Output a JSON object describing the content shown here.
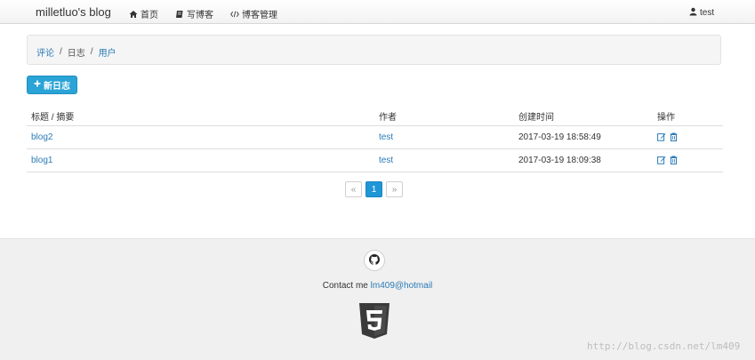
{
  "navbar": {
    "brand": "milletluo's blog",
    "items": [
      {
        "label": "首页",
        "icon": "home-icon"
      },
      {
        "label": "写博客",
        "icon": "book-icon"
      },
      {
        "label": "博客管理",
        "icon": "code-icon"
      }
    ],
    "user": {
      "label": "test",
      "icon": "user-icon"
    }
  },
  "breadcrumb": {
    "items": [
      {
        "label": "评论",
        "active": false
      },
      {
        "label": "日志",
        "active": true
      },
      {
        "label": "用户",
        "active": false
      }
    ],
    "separator": "/"
  },
  "actions": {
    "new_button": "新日志",
    "new_icon": "plus-icon"
  },
  "table": {
    "headers": [
      "标题 / 摘要",
      "作者",
      "创建时间",
      "操作"
    ],
    "rows": [
      {
        "title": "blog2",
        "author": "test",
        "created": "2017-03-19 18:58:49"
      },
      {
        "title": "blog1",
        "author": "test",
        "created": "2017-03-19 18:09:38"
      }
    ],
    "op_icons": [
      "edit-icon",
      "trash-icon"
    ]
  },
  "pagination": {
    "prev": "«",
    "current": "1",
    "next": "»"
  },
  "footer": {
    "contact_label": "Contact me",
    "contact_email": "lm409@hotmail",
    "icons": [
      "github-icon",
      "html5-logo-icon"
    ]
  },
  "watermark": "http://blog.csdn.net/lm409",
  "colors": {
    "accent": "#2aa3d6",
    "link": "#2a7ab6",
    "footer_bg": "#f0f0f0"
  }
}
